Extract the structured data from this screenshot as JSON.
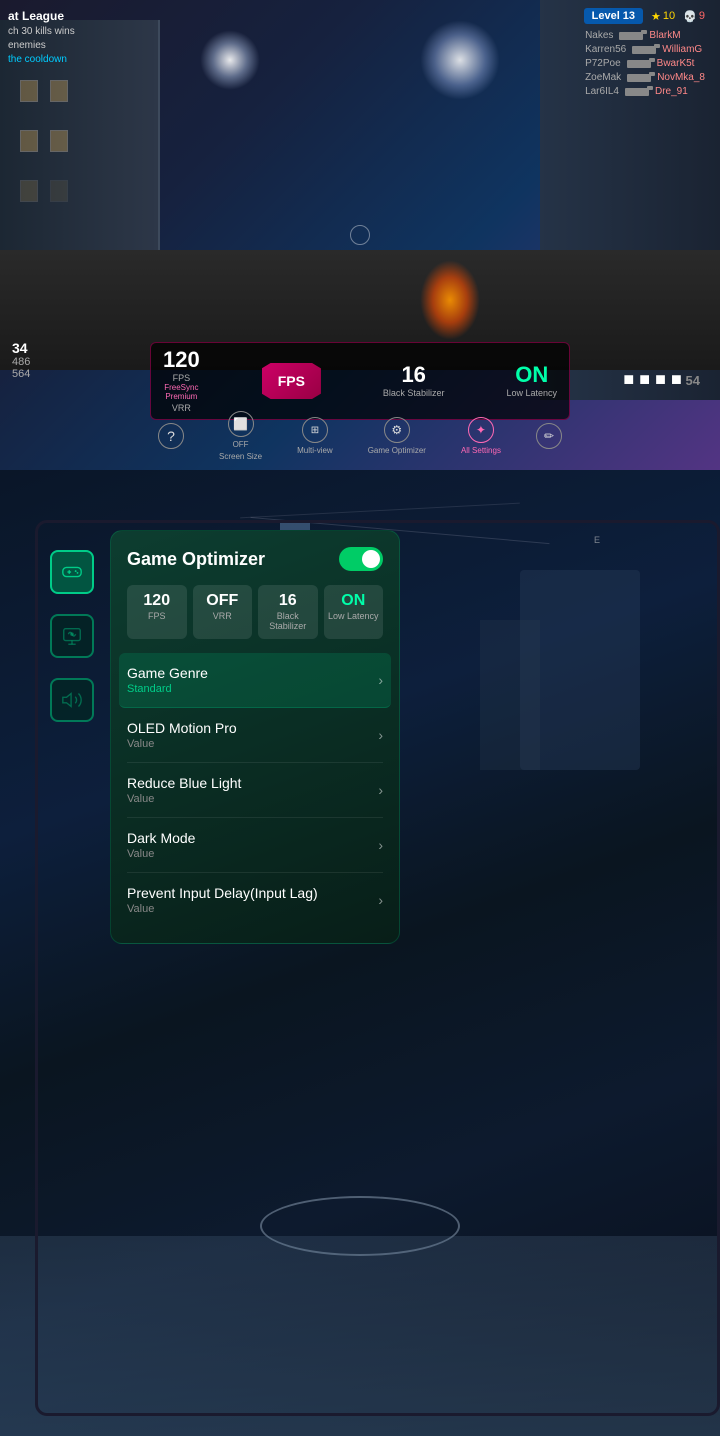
{
  "top": {
    "game_name": "at League",
    "mission_text": "ch 30 kills wins",
    "enemies_text": "enemies",
    "cooldown_text": "the cooldown",
    "level": "Level 13",
    "stars": "10",
    "skulls": "9",
    "players": [
      {
        "name1": "Nakes",
        "name2": "BlarkM"
      },
      {
        "name1": "Karren56",
        "name2": "WilliamG"
      },
      {
        "name1": "P72Poe",
        "name2": "BwarK5t"
      },
      {
        "name1": "ZoeMak",
        "name2": "NovMka_8"
      },
      {
        "name1": "Lar6IL4",
        "name2": "Dre_91"
      }
    ],
    "fps_value": "120",
    "fps_label": "FPS",
    "vrr_value": "FreeSync",
    "vrr_sub": "Premium",
    "vrr_label": "VRR",
    "fps_center": "FPS",
    "black_stab_value": "16",
    "black_stab_label": "Black Stabilizer",
    "latency_value": "ON",
    "latency_label": "Low Latency",
    "nav": {
      "help_label": "",
      "screen_size_label": "OFF\nScreen Size",
      "multiview_label": "Multi-view",
      "game_optimizer_label": "Game Optimizer",
      "all_settings_label": "All Settings"
    }
  },
  "bottom": {
    "panel": {
      "title": "Game Optimizer",
      "toggle_state": "ON",
      "stats": [
        {
          "value": "120",
          "label": "FPS"
        },
        {
          "value": "OFF",
          "label": "VRR"
        },
        {
          "value": "16",
          "label": "Black Stabilizer"
        },
        {
          "value": "ON",
          "label": "Low Latency"
        }
      ],
      "menu_items": [
        {
          "title": "Game Genre",
          "sub": "Standard",
          "highlighted": true
        },
        {
          "title": "OLED Motion Pro",
          "sub": "Value",
          "highlighted": false
        },
        {
          "title": "Reduce Blue Light",
          "sub": "Value",
          "highlighted": false
        },
        {
          "title": "Dark Mode",
          "sub": "Value",
          "highlighted": false
        },
        {
          "title": "Prevent Input Delay(Input Lag)",
          "sub": "Value",
          "highlighted": false
        }
      ]
    },
    "side_icons": [
      {
        "label": "gamepad",
        "active": true,
        "symbol": "🎮"
      },
      {
        "label": "display",
        "active": false,
        "symbol": "✦"
      },
      {
        "label": "sound",
        "active": false,
        "symbol": "🔊"
      }
    ]
  }
}
